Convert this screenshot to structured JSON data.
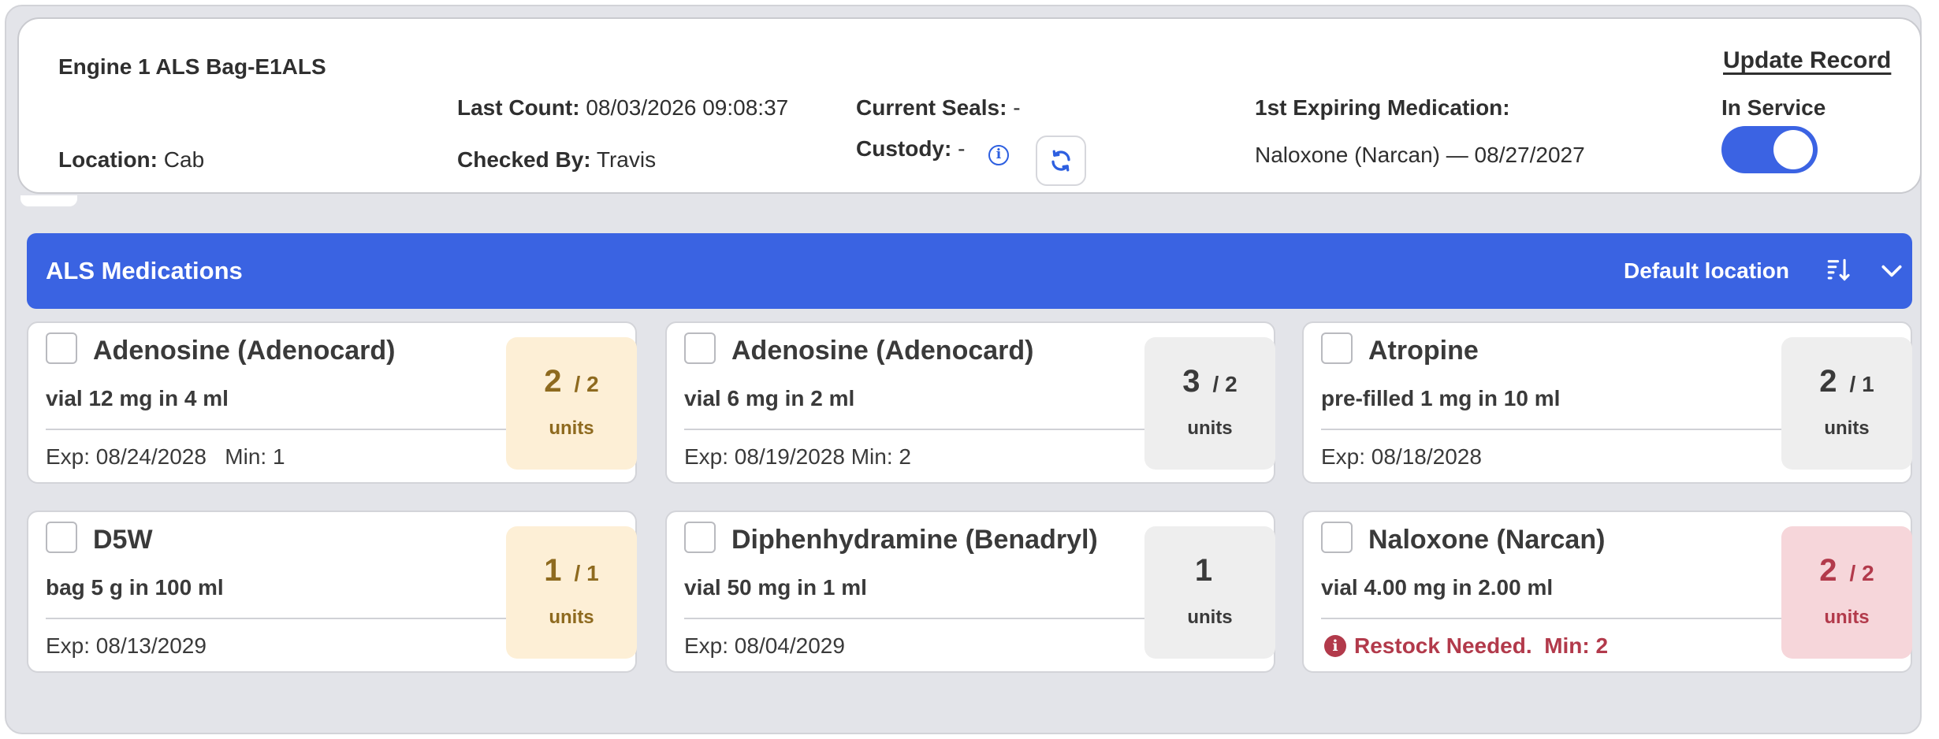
{
  "header": {
    "bag_title": "Engine 1 ALS Bag-E1ALS",
    "location_label": "Location:",
    "location_value": "Cab",
    "last_count_label": "Last Count:",
    "last_count_value": "08/03/2026 09:08:37",
    "checked_by_label": "Checked By:",
    "checked_by_value": "Travis",
    "current_seals_label": "Current Seals:",
    "current_seals_value": "-",
    "custody_label": "Custody:",
    "custody_value": "-",
    "first_expiring_label": "1st Expiring Medication:",
    "first_expiring_value": "Naloxone (Narcan) — 08/27/2027",
    "update_record_label": "Update Record",
    "in_service_label": "In Service",
    "in_service_on": true,
    "info_icon": "info-icon",
    "refresh_icon": "refresh-icon"
  },
  "section": {
    "title": "ALS Medications",
    "location_label": "Default location",
    "sort_icon": "sort-icon",
    "collapse_icon": "chevron-down-icon",
    "accent_color": "#3a63e2"
  },
  "medications": [
    {
      "name": "Adenosine (Adenocard)",
      "desc": "vial 12 mg in 4 ml",
      "footer": "Exp: 08/24/2028   Min: 1",
      "count": "2",
      "par": "/ 2",
      "units": "units",
      "status": "full"
    },
    {
      "name": "Adenosine (Adenocard)",
      "desc": "vial 6 mg in 2 ml",
      "footer": "Exp: 08/19/2028 Min: 2",
      "count": "3",
      "par": "/ 2",
      "units": "units",
      "status": "ok"
    },
    {
      "name": "Atropine",
      "desc": "pre-filled 1 mg in 10 ml",
      "footer": "Exp: 08/18/2028",
      "count": "2",
      "par": "/ 1",
      "units": "units",
      "status": "ok"
    },
    {
      "name": "D5W",
      "desc": "bag 5 g in 100 ml",
      "footer": "Exp: 08/13/2029",
      "count": "1",
      "par": "/ 1",
      "units": "units",
      "status": "full"
    },
    {
      "name": "Diphenhydramine (Benadryl)",
      "desc": "vial 50 mg in 1 ml",
      "footer": "Exp: 08/04/2029",
      "count": "1",
      "par": "",
      "units": "units",
      "status": "ok"
    },
    {
      "name": "Naloxone (Narcan)",
      "desc": "vial 4.00 mg in 2.00 ml",
      "footer": "Restock Needed.  Min: 2",
      "count": "2",
      "par": "/ 2",
      "units": "units",
      "status": "low",
      "alert": true
    }
  ],
  "status_colors": {
    "ok": "#eeeeee",
    "full": "#fdefd6",
    "low": "#f6d6da",
    "alert_text": "#b23a4b"
  }
}
